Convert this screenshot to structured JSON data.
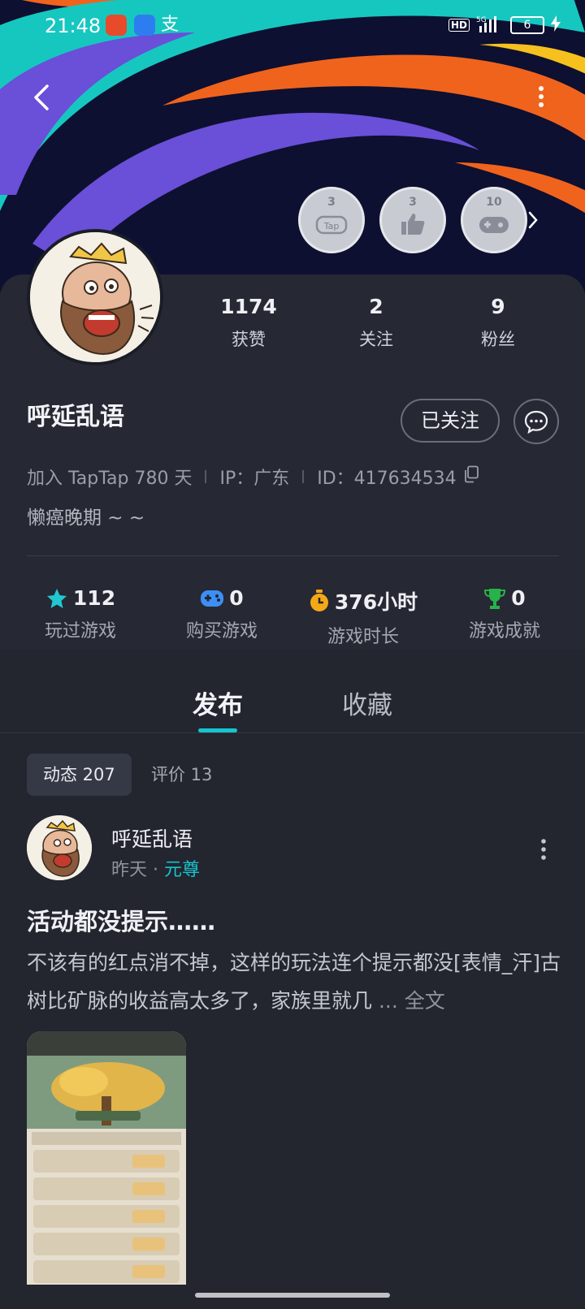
{
  "status_bar": {
    "time": "21:48",
    "network": "5G",
    "battery": "6"
  },
  "profile": {
    "name": "呼延乱语",
    "follow_label": "已关注",
    "meta": {
      "joined": "加入 TapTap 780 天",
      "ip": "IP：广东",
      "id": "ID：417634534"
    },
    "bio": "懒癌晚期 ~ ~",
    "stats": [
      {
        "value": "1174",
        "label": "获赞"
      },
      {
        "value": "2",
        "label": "关注"
      },
      {
        "value": "9",
        "label": "粉丝"
      }
    ],
    "badges": [
      {
        "count": "3"
      },
      {
        "count": "3"
      },
      {
        "count": "10"
      }
    ],
    "game_stats": [
      {
        "value": "112",
        "label": "玩过游戏",
        "icon": "star-icon",
        "color": "#22c7d0"
      },
      {
        "value": "0",
        "label": "购买游戏",
        "icon": "gamepad-icon",
        "color": "#3d8ff5"
      },
      {
        "value": "376小时",
        "label": "游戏时长",
        "icon": "stopwatch-icon",
        "color": "#f3a917"
      },
      {
        "value": "0",
        "label": "游戏成就",
        "icon": "trophy-icon",
        "color": "#27b34a"
      }
    ]
  },
  "tabs": [
    {
      "label": "发布",
      "active": true
    },
    {
      "label": "收藏",
      "active": false
    }
  ],
  "filters": [
    {
      "label": "动态 207",
      "active": true
    },
    {
      "label": "评价 13",
      "active": false
    }
  ],
  "post": {
    "author": "呼延乱语",
    "time": "昨天",
    "tag": "元尊",
    "title": "活动都没提示……",
    "body": "不该有的红点消不掉，这样的玩法连个提示都没[表情_汗]古树比矿脉的收益高太多了，家族里就几",
    "more_label": "... 全文"
  },
  "colors": {
    "accent": "#15c5ce",
    "background": "#23252f"
  }
}
